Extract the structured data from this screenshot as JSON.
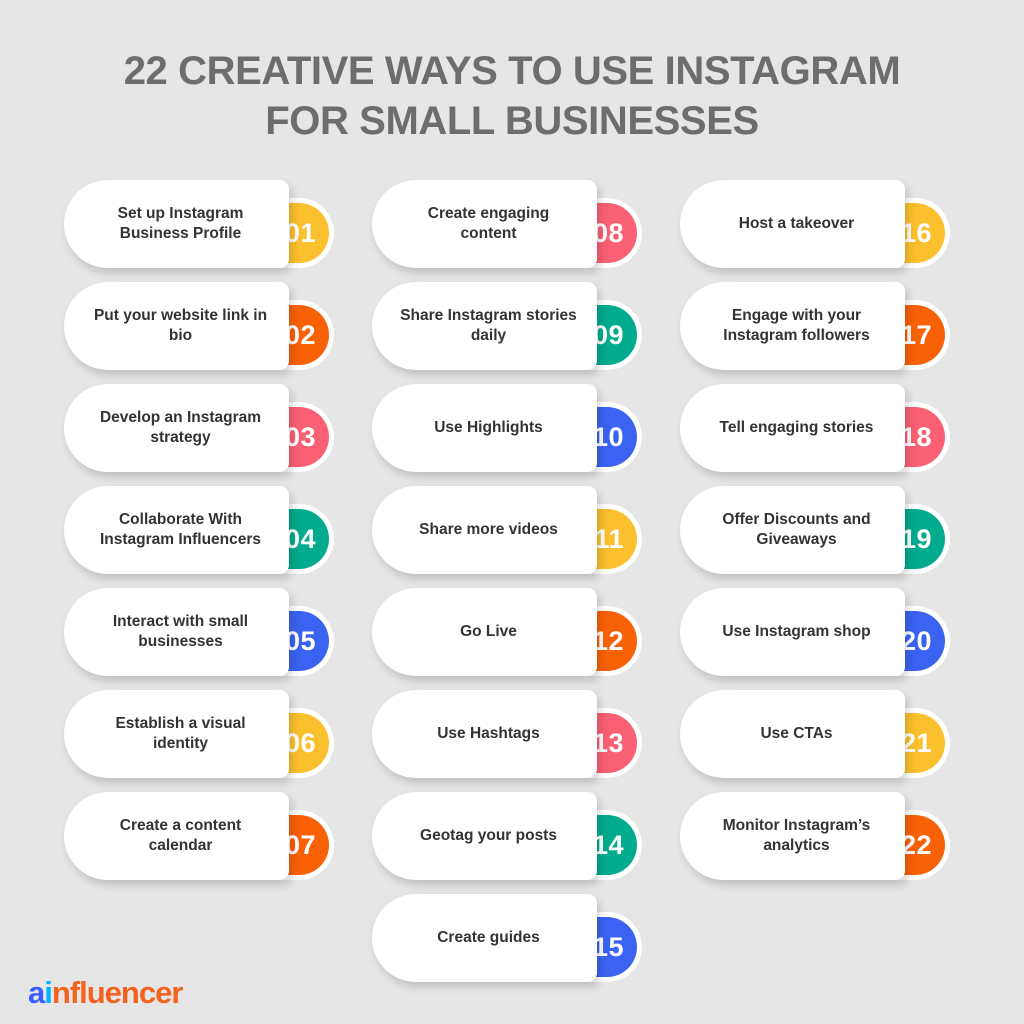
{
  "title": {
    "line1": "22 CREATIVE WAYS TO USE INSTAGRAM",
    "line2": "FOR SMALL BUSINESSES",
    "color": "#6d6d6d"
  },
  "background_color": "#e6e6e6",
  "palette": {
    "yellow": "#FBC02D",
    "orange": "#F96107",
    "pink": "#FA6074",
    "teal": "#00AB8E",
    "blue": "#3B63F2",
    "card_text": "#333333",
    "card_bg": "#ffffff"
  },
  "logo": {
    "part_a": "a",
    "part_i": "i",
    "part_rest": "nfluencer",
    "color_a": "#3b5bfd",
    "color_i": "#00b2ff",
    "color_rest": "#f4621f"
  },
  "columns": [
    {
      "name": "column-1",
      "items": [
        {
          "number": "01",
          "label": "Set up Instagram Business Profile",
          "color": "#FBC02D"
        },
        {
          "number": "02",
          "label": "Put your website link in bio",
          "color": "#F96107"
        },
        {
          "number": "03",
          "label": "Develop an Instagram strategy",
          "color": "#FA6074"
        },
        {
          "number": "04",
          "label": "Collaborate With Instagram Influencers",
          "color": "#00AB8E"
        },
        {
          "number": "05",
          "label": "Interact with small businesses",
          "color": "#3B63F2"
        },
        {
          "number": "06",
          "label": "Establish a visual identity",
          "color": "#FBC02D"
        },
        {
          "number": "07",
          "label": "Create a content calendar",
          "color": "#F96107"
        }
      ]
    },
    {
      "name": "column-2",
      "items": [
        {
          "number": "08",
          "label": "Create engaging content",
          "color": "#FA6074"
        },
        {
          "number": "09",
          "label": "Share Instagram stories daily",
          "color": "#00AB8E"
        },
        {
          "number": "10",
          "label": "Use Highlights",
          "color": "#3B63F2"
        },
        {
          "number": "11",
          "label": "Share more videos",
          "color": "#FBC02D"
        },
        {
          "number": "12",
          "label": "Go Live",
          "color": "#F96107"
        },
        {
          "number": "13",
          "label": "Use Hashtags",
          "color": "#FA6074"
        },
        {
          "number": "14",
          "label": "Geotag your posts",
          "color": "#00AB8E"
        },
        {
          "number": "15",
          "label": "Create guides",
          "color": "#3B63F2"
        }
      ]
    },
    {
      "name": "column-3",
      "items": [
        {
          "number": "16",
          "label": "Host a takeover",
          "color": "#FBC02D"
        },
        {
          "number": "17",
          "label": "Engage with your Instagram followers",
          "color": "#F96107"
        },
        {
          "number": "18",
          "label": "Tell engaging stories",
          "color": "#FA6074"
        },
        {
          "number": "19",
          "label": "Offer Discounts and Giveaways",
          "color": "#00AB8E"
        },
        {
          "number": "20",
          "label": "Use Instagram shop",
          "color": "#3B63F2"
        },
        {
          "number": "21",
          "label": "Use CTAs",
          "color": "#FBC02D"
        },
        {
          "number": "22",
          "label": "Monitor Instagram’s analytics",
          "color": "#F96107"
        }
      ]
    }
  ]
}
